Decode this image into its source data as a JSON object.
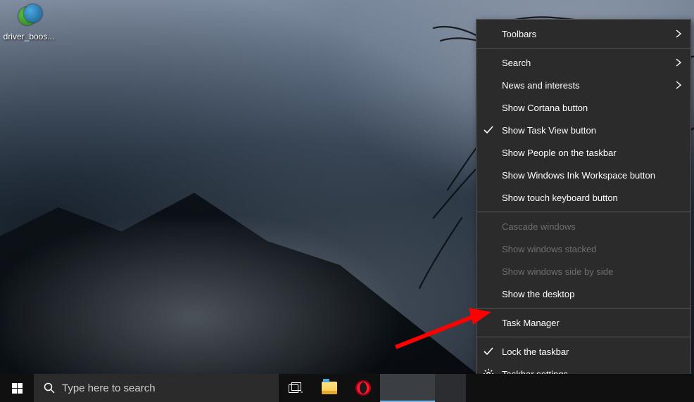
{
  "desktop": {
    "icons": [
      {
        "label": "driver_boos..."
      }
    ]
  },
  "taskbar": {
    "search_placeholder": "Type here to search"
  },
  "context_menu": {
    "items": [
      {
        "label": "Toolbars",
        "has_submenu": true
      },
      {
        "label": "Search",
        "has_submenu": true
      },
      {
        "label": "News and interests",
        "has_submenu": true
      },
      {
        "label": "Show Cortana button"
      },
      {
        "label": "Show Task View button",
        "checked": true
      },
      {
        "label": "Show People on the taskbar"
      },
      {
        "label": "Show Windows Ink Workspace button"
      },
      {
        "label": "Show touch keyboard button"
      },
      {
        "label": "Cascade windows",
        "disabled": true
      },
      {
        "label": "Show windows stacked",
        "disabled": true
      },
      {
        "label": "Show windows side by side",
        "disabled": true
      },
      {
        "label": "Show the desktop"
      },
      {
        "label": "Task Manager"
      },
      {
        "label": "Lock the taskbar",
        "checked": true
      },
      {
        "label": "Taskbar settings",
        "icon": "gear"
      }
    ]
  }
}
